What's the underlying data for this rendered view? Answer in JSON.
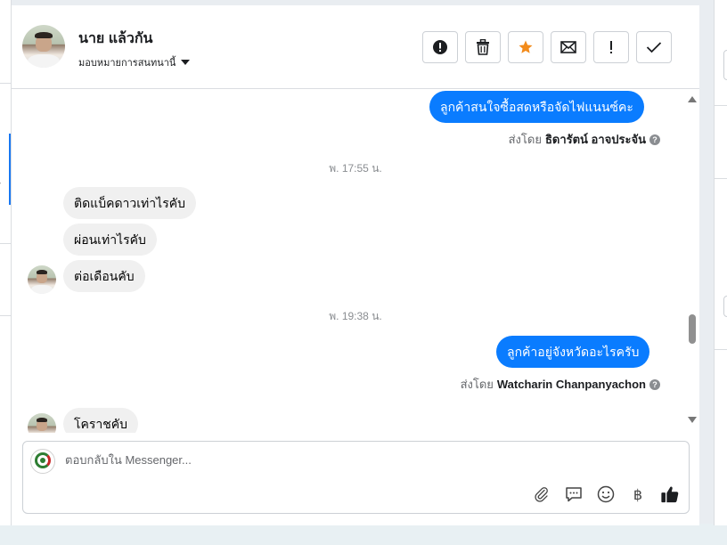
{
  "header": {
    "contact_name": "นาย แล้วกัน",
    "assign_label": "มอบหมายการสนทนานี้",
    "actions": [
      {
        "name": "report-button",
        "symbol": "!"
      },
      {
        "name": "delete-button",
        "symbol": "trash"
      },
      {
        "name": "star-button",
        "symbol": "★"
      },
      {
        "name": "mark-unread-button",
        "symbol": "✉"
      },
      {
        "name": "spam-button",
        "symbol": "!"
      },
      {
        "name": "done-button",
        "symbol": "✓"
      }
    ]
  },
  "messages": {
    "m1": "ลูกค้าสนใจซื้อสดหรือจัดไฟแนนซ์คะ",
    "m1_sent_prefix": "ส่งโดย",
    "m1_sender": "ธิดารัตน์ อาจประจัน",
    "time1": "พ. 17:55 น.",
    "m2": "ติดแบ็คดาวเท่าไรคับ",
    "m3": "ผ่อนเท่าไรคับ",
    "m4": "ต่อเดือนคับ",
    "time2": "พ. 19:38 น.",
    "m5": "ลูกค้าอยู่จังหวัดอะไรครับ",
    "m5_sent_prefix": "ส่งโดย",
    "m5_sender": "Watcharin Chanpanyachon",
    "m6": "โคราชคับ"
  },
  "composer": {
    "placeholder": "ตอบกลับใน Messenger...",
    "currency_symbol": "฿"
  },
  "colors": {
    "outgoing_bubble": "#0a7cff",
    "incoming_bubble": "#f0f0f0",
    "star": "#f28b1b"
  }
}
